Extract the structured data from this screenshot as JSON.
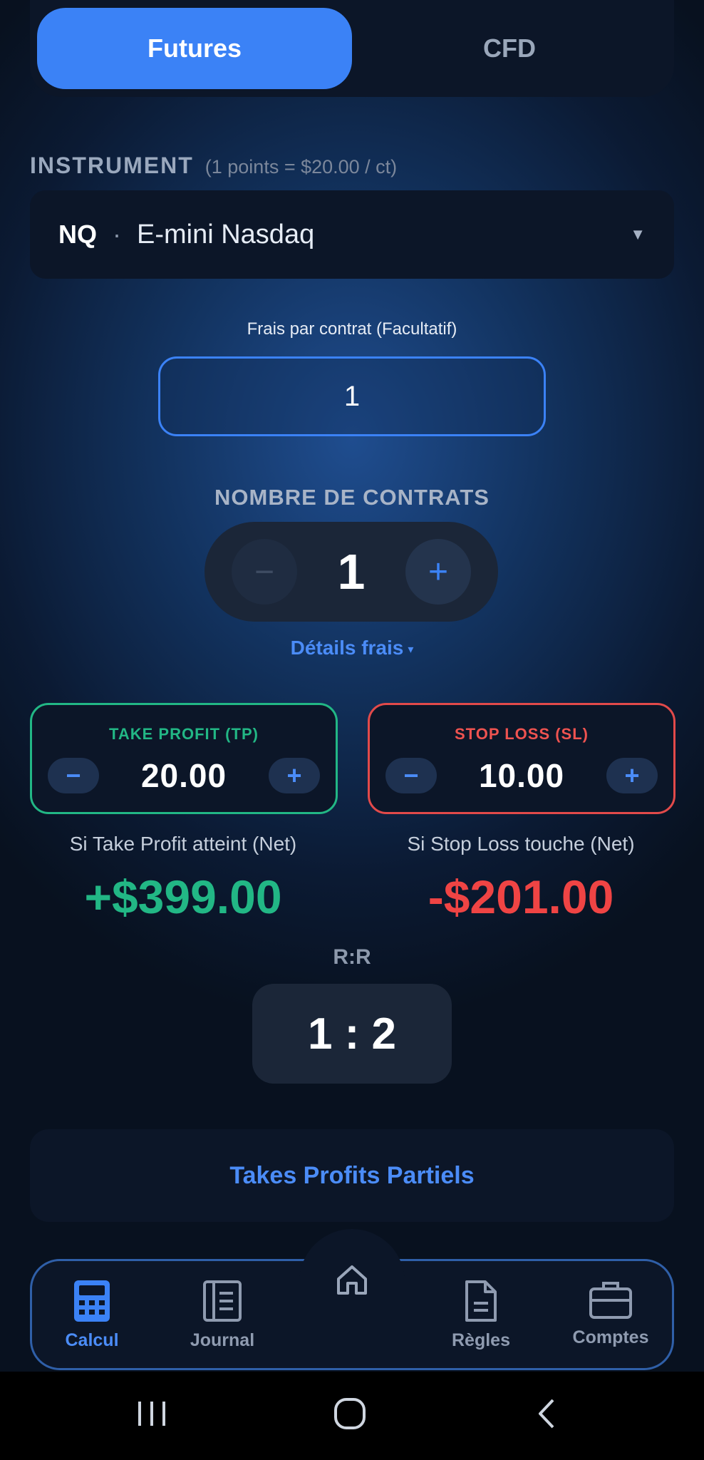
{
  "tabs": [
    {
      "label": "Futures",
      "active": true
    },
    {
      "label": "CFD",
      "active": false
    }
  ],
  "instrument": {
    "title": "INSTRUMENT",
    "subtitle": "(1 points = $20.00 / ct)",
    "code": "NQ",
    "separator": "·",
    "name": "E-mini Nasdaq"
  },
  "fees": {
    "label": "Frais par contrat (Facultatif)",
    "value": "1"
  },
  "contracts": {
    "title": "NOMBRE DE CONTRATS",
    "minus": "−",
    "value": "1",
    "plus": "+"
  },
  "details_link": {
    "label": "Détails frais",
    "caret": "▾"
  },
  "take_profit": {
    "title": "TAKE PROFIT (TP)",
    "minus": "−",
    "value": "20.00",
    "plus": "+",
    "result_label": "Si Take Profit atteint (Net)",
    "result_value": "+$399.00"
  },
  "stop_loss": {
    "title": "STOP LOSS (SL)",
    "minus": "−",
    "value": "10.00",
    "plus": "+",
    "result_label": "Si Stop Loss touche (Net)",
    "result_value": "-$201.00"
  },
  "risk_reward": {
    "label": "R:R",
    "value": "1 : 2"
  },
  "partial_tp": {
    "label": "Takes Profits Partiels"
  },
  "nav": {
    "items": [
      {
        "label": "Calcul",
        "icon": "calculator-icon",
        "active": true
      },
      {
        "label": "Journal",
        "icon": "journal-icon",
        "active": false
      },
      {
        "label": "Règles",
        "icon": "document-icon",
        "active": false
      },
      {
        "label": "Comptes",
        "icon": "briefcase-icon",
        "active": false
      }
    ],
    "home_icon": "home-icon"
  },
  "colors": {
    "accent": "#3b82f6",
    "profit": "#22b785",
    "loss": "#ef4444",
    "panel": "#0c1628"
  }
}
